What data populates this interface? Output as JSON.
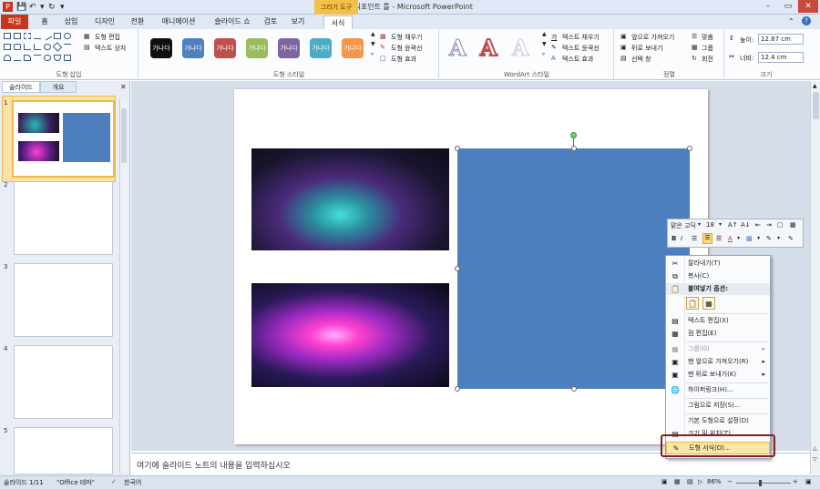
{
  "titlebar": {
    "title": "파워포인트 틀 - Microsoft PowerPoint",
    "context_tab": "그리기 도구"
  },
  "tabs": [
    "파일",
    "홈",
    "삽입",
    "디자인",
    "전환",
    "애니메이션",
    "슬라이드 쇼",
    "검토",
    "보기",
    "서식"
  ],
  "ribbon": {
    "insert_shapes": {
      "edit_shape": "도형 편집",
      "text_box": "텍스트 상자",
      "label": "도형 삽입"
    },
    "shape_styles": {
      "style_text": "가나다",
      "fill": "도형 채우기",
      "outline": "도형 윤곽선",
      "effects": "도형 효과",
      "label": "도형 스타일",
      "colors": [
        "#111111",
        "#4f81bd",
        "#c0504d",
        "#9bbb59",
        "#8064a2",
        "#4bacc6",
        "#f79646"
      ]
    },
    "wordart": {
      "text_fill": "텍스트 채우기",
      "text_outline": "텍스트 윤곽선",
      "text_effects": "텍스트 효과",
      "label": "WordArt 스타일"
    },
    "arrange": {
      "bring_forward": "앞으로 가져오기",
      "send_backward": "뒤로 보내기",
      "selection_pane": "선택 창",
      "align": "맞춤",
      "group": "그룹",
      "rotate": "회전",
      "label": "정렬"
    },
    "size": {
      "height_label": "높이:",
      "height": "12.87 cm",
      "width_label": "너비:",
      "width": "12.4 cm",
      "label": "크기"
    }
  },
  "panel": {
    "tab_slides": "슬라이드",
    "tab_outline": "개요",
    "slide_numbers": [
      "1",
      "2",
      "3",
      "4",
      "5"
    ]
  },
  "minitoolbar": {
    "font": "맑은 고딕",
    "size": "18"
  },
  "context_menu": {
    "cut": "잘라내기(T)",
    "copy": "복사(C)",
    "paste_options": "붙여넣기 옵션:",
    "edit_text": "텍스트 편집(X)",
    "edit_points": "점 편집(E)",
    "group": "그룹(G)",
    "bring_to_front": "맨 앞으로 가져오기(R)",
    "send_to_back": "맨 뒤로 보내기(K)",
    "hyperlink": "하이퍼링크(H)...",
    "save_as_picture": "그림으로 저장(S)...",
    "set_default_shape": "기본 도형으로 설정(D)",
    "size_position": "크기 및 위치(Z)...",
    "format_shape": "도형 서식(O)..."
  },
  "notes": {
    "placeholder": "여기에 슬라이드 노트의 내용을 입력하십시오"
  },
  "status": {
    "slide": "슬라이드 1/11",
    "theme": "\"Office 테마\"",
    "language": "한국어",
    "zoom": "86%"
  }
}
